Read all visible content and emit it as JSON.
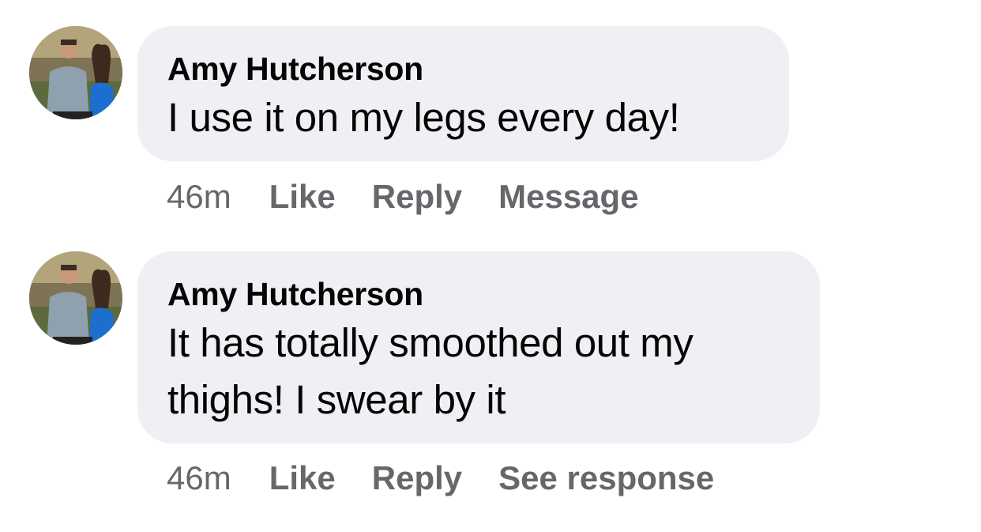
{
  "comments": [
    {
      "author": "Amy Hutcherson",
      "text": "I use it on my legs every day!",
      "time": "46m",
      "actions": [
        "Like",
        "Reply",
        "Message"
      ],
      "avatar_icon": "couple-photo-avatar"
    },
    {
      "author": "Amy Hutcherson",
      "text": "It has totally smoothed out my thighs! I swear by it",
      "text_line1": "It has totally smoothed out my",
      "text_line2": "thighs! I swear by it",
      "time": "46m",
      "actions": [
        "Like",
        "Reply",
        "See response"
      ],
      "avatar_icon": "couple-photo-avatar"
    }
  ],
  "colors": {
    "bubble_bg": "#eff0f3",
    "meta_text": "#65676b",
    "body_text": "#050505"
  }
}
